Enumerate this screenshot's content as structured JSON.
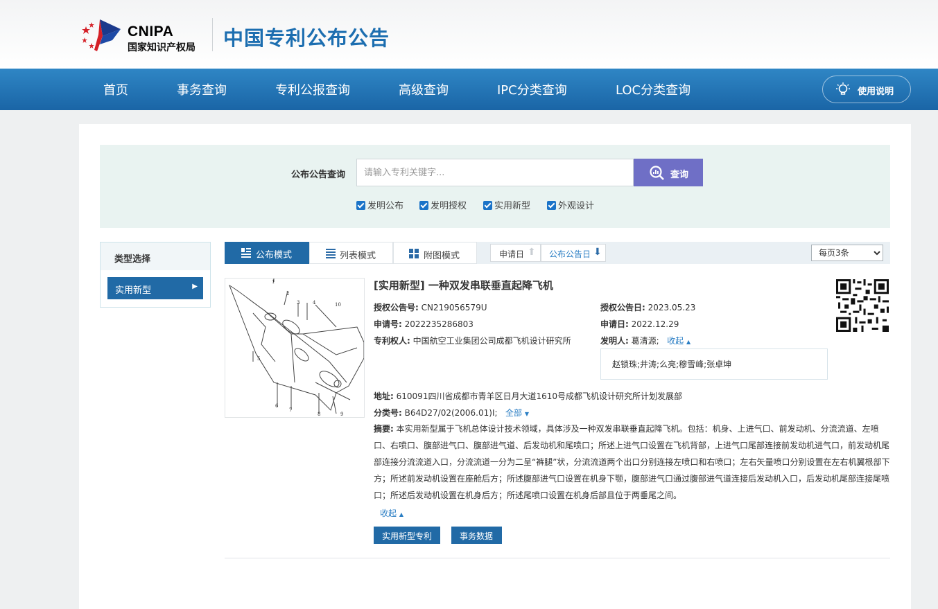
{
  "header": {
    "logo_text": "CNIPA",
    "logo_subtitle": "国家知识产权局",
    "site_title": "中国专利公布公告"
  },
  "nav": {
    "items": [
      "首页",
      "事务查询",
      "专利公报查询",
      "高级查询",
      "IPC分类查询",
      "LOC分类查询"
    ],
    "help_label": "使用说明"
  },
  "search": {
    "label": "公布公告查询",
    "placeholder": "请输入专利关键字...",
    "button_label": "查询",
    "checkboxes": [
      {
        "label": "发明公布",
        "checked": true
      },
      {
        "label": "发明授权",
        "checked": true
      },
      {
        "label": "实用新型",
        "checked": true
      },
      {
        "label": "外观设计",
        "checked": true
      }
    ]
  },
  "sidebar": {
    "title": "类型选择",
    "item": "实用新型"
  },
  "toolbar": {
    "modes": [
      "公布模式",
      "列表模式",
      "附图模式"
    ],
    "active_mode": "公布模式",
    "sort_apply_date": "申请日",
    "sort_pub_date": "公布公告日",
    "per_page": "每页3条"
  },
  "result": {
    "title": "[实用新型] 一种双发串联垂直起降飞机",
    "grant_pub_no_label": "授权公告号:",
    "grant_pub_no": "CN219056579U",
    "grant_pub_date_label": "授权公告日:",
    "grant_pub_date": "2023.05.23",
    "app_no_label": "申请号:",
    "app_no": "2022235286803",
    "app_date_label": "申请日:",
    "app_date": "2022.12.29",
    "patentee_label": "专利权人:",
    "patentee": "中国航空工业集团公司成都飞机设计研究所",
    "inventor_label": "发明人:",
    "inventor_first": "葛清源;",
    "collapse_label": "收起",
    "inventors_rest": "赵锁珠;井涛;么亮;穆雪峰;张卓坤",
    "address_label": "地址:",
    "address": "610091四川省成都市青羊区日月大道1610号成都飞机设计研究所计划发展部",
    "class_label": "分类号:",
    "class_no": "B64D27/02(2006.01)I;",
    "class_all": "全部",
    "abstract_label": "摘要:",
    "abstract": "本实用新型属于飞机总体设计技术领域，具体涉及一种双发串联垂直起降飞机。包括：机身、上进气口、前发动机、分流流道、左喷口、右喷口、腹部进气口、腹部进气道、后发动机和尾喷口；所述上进气口设置在飞机背部，上进气口尾部连接前发动机进气口，前发动机尾部连接分流流道入口，分流流道一分为二呈“裤腿”状，分流流道两个出口分别连接左喷口和右喷口；左右矢量喷口分别设置在左右机翼根部下方；所述前发动机设置在座舱后方；所述腹部进气口设置在机身下颚，腹部进气口通过腹部进气道连接后发动机入口，后发动机尾部连接尾喷口；所述后发动机设置在机身后方；所述尾喷口设置在机身后部且位于两垂尾之间。",
    "abstract_collapse": "收起",
    "btn_patent": "实用新型专利",
    "btn_affairs": "事务数据",
    "figure_labels": [
      "1",
      "2",
      "3",
      "4",
      "10",
      "5",
      "6",
      "7",
      "8",
      "9"
    ]
  }
}
